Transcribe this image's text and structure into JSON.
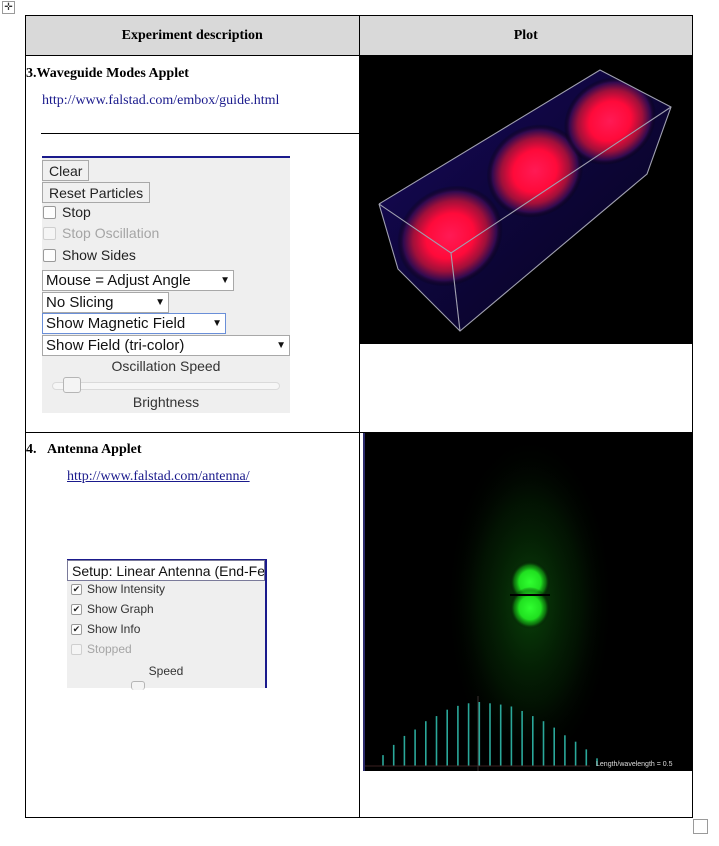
{
  "table": {
    "headers": [
      "Experiment description",
      "Plot"
    ]
  },
  "experiments": [
    {
      "title": "3.Waveguide Modes Applet",
      "link": "http://www.falstad.com/embox/guide.html",
      "applet": {
        "buttons": [
          "Clear",
          "Reset Particles"
        ],
        "checkboxes": [
          {
            "label": "Stop",
            "checked": false,
            "disabled": false
          },
          {
            "label": "Stop Oscillation",
            "checked": false,
            "disabled": true
          },
          {
            "label": "Show Sides",
            "checked": false,
            "disabled": false
          }
        ],
        "selects": [
          {
            "value": "Mouse = Adjust Angle"
          },
          {
            "value": "No Slicing"
          },
          {
            "value": "Show Magnetic Field",
            "focused": true
          },
          {
            "value": "Show Field (tri-color)"
          }
        ],
        "slider_label": "Oscillation Speed",
        "slider_value_fraction": 0.05,
        "footer_label": "Brightness"
      },
      "plot": {
        "description": "3D waveguide box with red/blue field intensity lobes",
        "colors": {
          "field_high": "#ff1040",
          "field_low": "#1a0a6a",
          "edge": "#a0a0b0",
          "background": "#000000"
        }
      }
    },
    {
      "title_number": "4.",
      "title": "Antenna Applet",
      "link": "http://www.falstad.com/antenna/",
      "applet": {
        "setup_select": "Setup: Linear Antenna (End-Fed",
        "checkboxes": [
          {
            "label": "Show Intensity",
            "checked": true,
            "disabled": false
          },
          {
            "label": "Show Graph",
            "checked": true,
            "disabled": false
          },
          {
            "label": "Show Info",
            "checked": true,
            "disabled": false
          },
          {
            "label": "Stopped",
            "checked": false,
            "disabled": true
          }
        ],
        "slider_label": "Speed"
      },
      "plot": {
        "caption": "Length/wavelength = 0.5",
        "colors": {
          "glow": "#20ff20",
          "bars": "#2aa89a",
          "background": "#000000"
        },
        "bar_heights": [
          0.17,
          0.33,
          0.47,
          0.57,
          0.7,
          0.78,
          0.88,
          0.94,
          0.98,
          1.0,
          0.98,
          0.96,
          0.93,
          0.86,
          0.78,
          0.7,
          0.6,
          0.48,
          0.38,
          0.26,
          0.12
        ]
      }
    }
  ],
  "icons": {
    "move_handle": "four-arrows",
    "check": "✔",
    "arrow": "▼"
  }
}
